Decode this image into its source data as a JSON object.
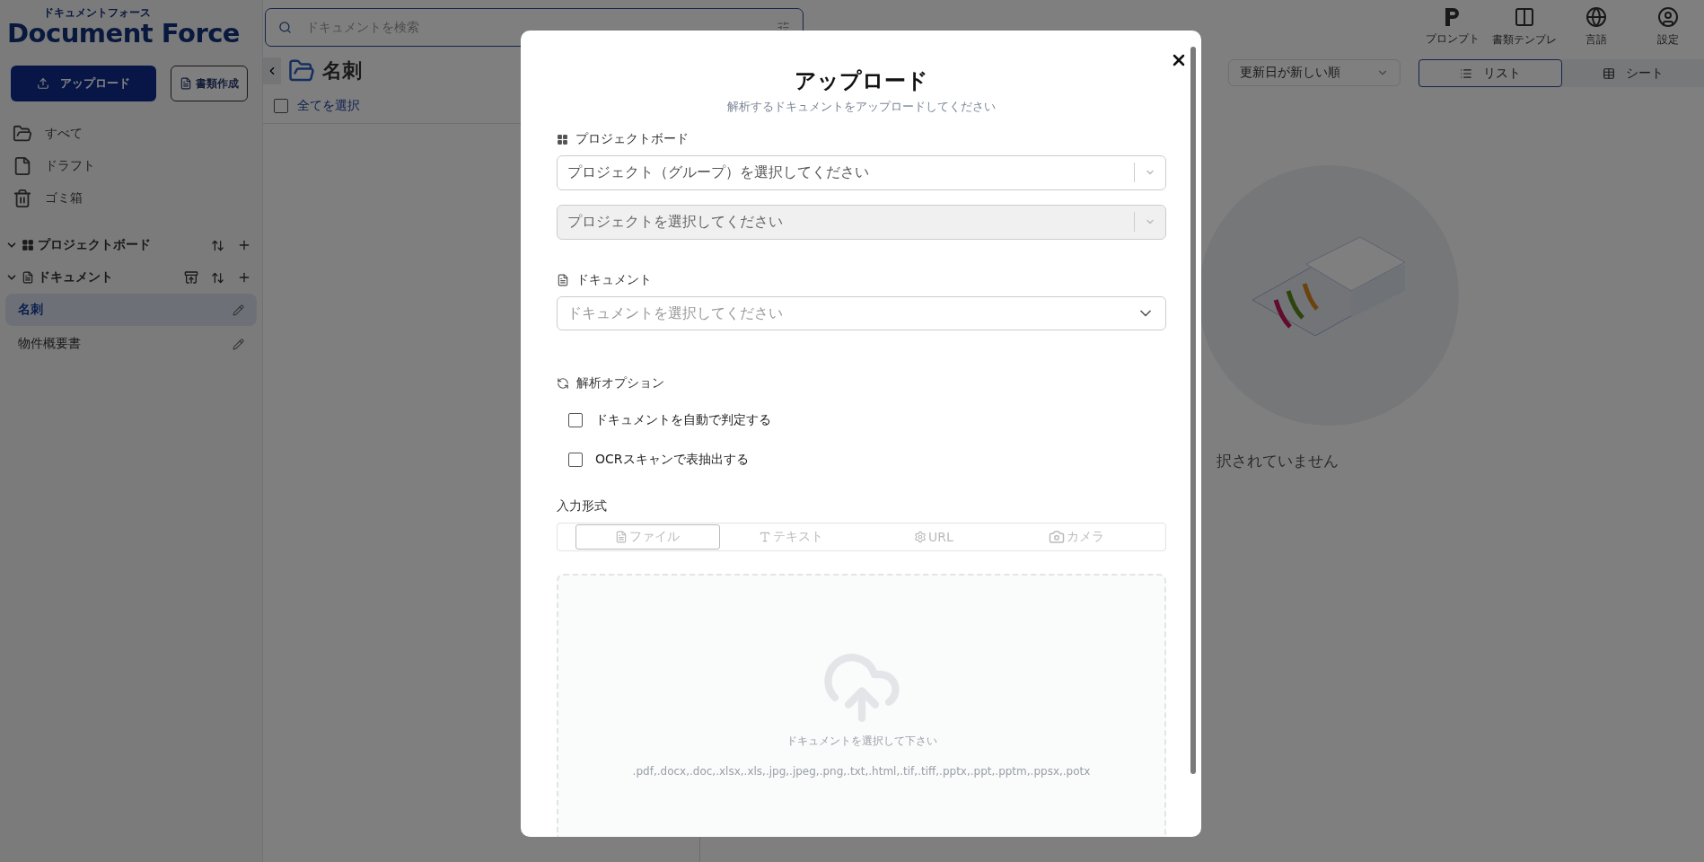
{
  "app": {
    "logo_kana": "ドキュメントフォース",
    "logo": "Document Force"
  },
  "search": {
    "placeholder": "ドキュメントを検索"
  },
  "header_actions": [
    {
      "kind": "prompt",
      "label": "プロンプト"
    },
    {
      "kind": "template",
      "label": "書類テンプレ"
    },
    {
      "kind": "language",
      "label": "言語"
    },
    {
      "kind": "settings",
      "label": "設定"
    }
  ],
  "sidebar": {
    "upload_button": "アップロード",
    "create_button": "書類作成",
    "nav": [
      {
        "kind": "folder",
        "label": "すべて"
      },
      {
        "kind": "draft",
        "label": "ドラフト"
      },
      {
        "kind": "trash",
        "label": "ゴミ箱"
      }
    ],
    "sections": [
      {
        "kind": "board",
        "label": "プロジェクトボード",
        "expanded": true
      },
      {
        "kind": "document",
        "label": "ドキュメント",
        "expanded": true,
        "children": [
          {
            "label": "名刺",
            "selected": true
          },
          {
            "label": "物件概要書",
            "selected": false
          }
        ]
      }
    ]
  },
  "list_panel": {
    "title": "名刺",
    "select_all": {
      "label": "全てを選択",
      "checked": false
    }
  },
  "sort": {
    "value": "更新日が新しい順"
  },
  "view_tabs": [
    {
      "kind": "list",
      "label": "リスト",
      "selected": true
    },
    {
      "kind": "sheet",
      "label": "シート",
      "selected": false
    }
  ],
  "empty_state": {
    "message": "択されていません"
  },
  "modal": {
    "title": "アップロード",
    "subtitle": "解析するドキュメントをアップロードしてください",
    "project_section": {
      "label": "プロジェクトボード",
      "group_select": {
        "placeholder": "プロジェクト（グループ）を選択してください",
        "disabled": false
      },
      "project_select": {
        "placeholder": "プロジェクトを選択してください",
        "disabled": true
      }
    },
    "document_section": {
      "label": "ドキュメント",
      "select": {
        "placeholder": "ドキュメントを選択してください"
      }
    },
    "options_section": {
      "label": "解析オプション",
      "options": [
        {
          "label": "ドキュメントを自動で判定する",
          "checked": false
        },
        {
          "label": "OCRスキャンで表抽出する",
          "checked": false
        }
      ]
    },
    "input_format": {
      "label": "入力形式",
      "tabs": [
        {
          "kind": "file",
          "label": "ファイル",
          "selected": true
        },
        {
          "kind": "text",
          "label": "テキスト",
          "selected": false
        },
        {
          "kind": "url",
          "label": "URL",
          "selected": false
        },
        {
          "kind": "camera",
          "label": "カメラ",
          "selected": false
        }
      ]
    },
    "dropzone": {
      "prompt": "ドキュメントを選択して下さい",
      "formats": ".pdf,.docx,.doc,.xlsx,.xls,.jpg,.jpeg,.png,.txt,.html,.tif,.tiff,.pptx,.ppt,.pptm,.ppsx,.potx"
    }
  }
}
